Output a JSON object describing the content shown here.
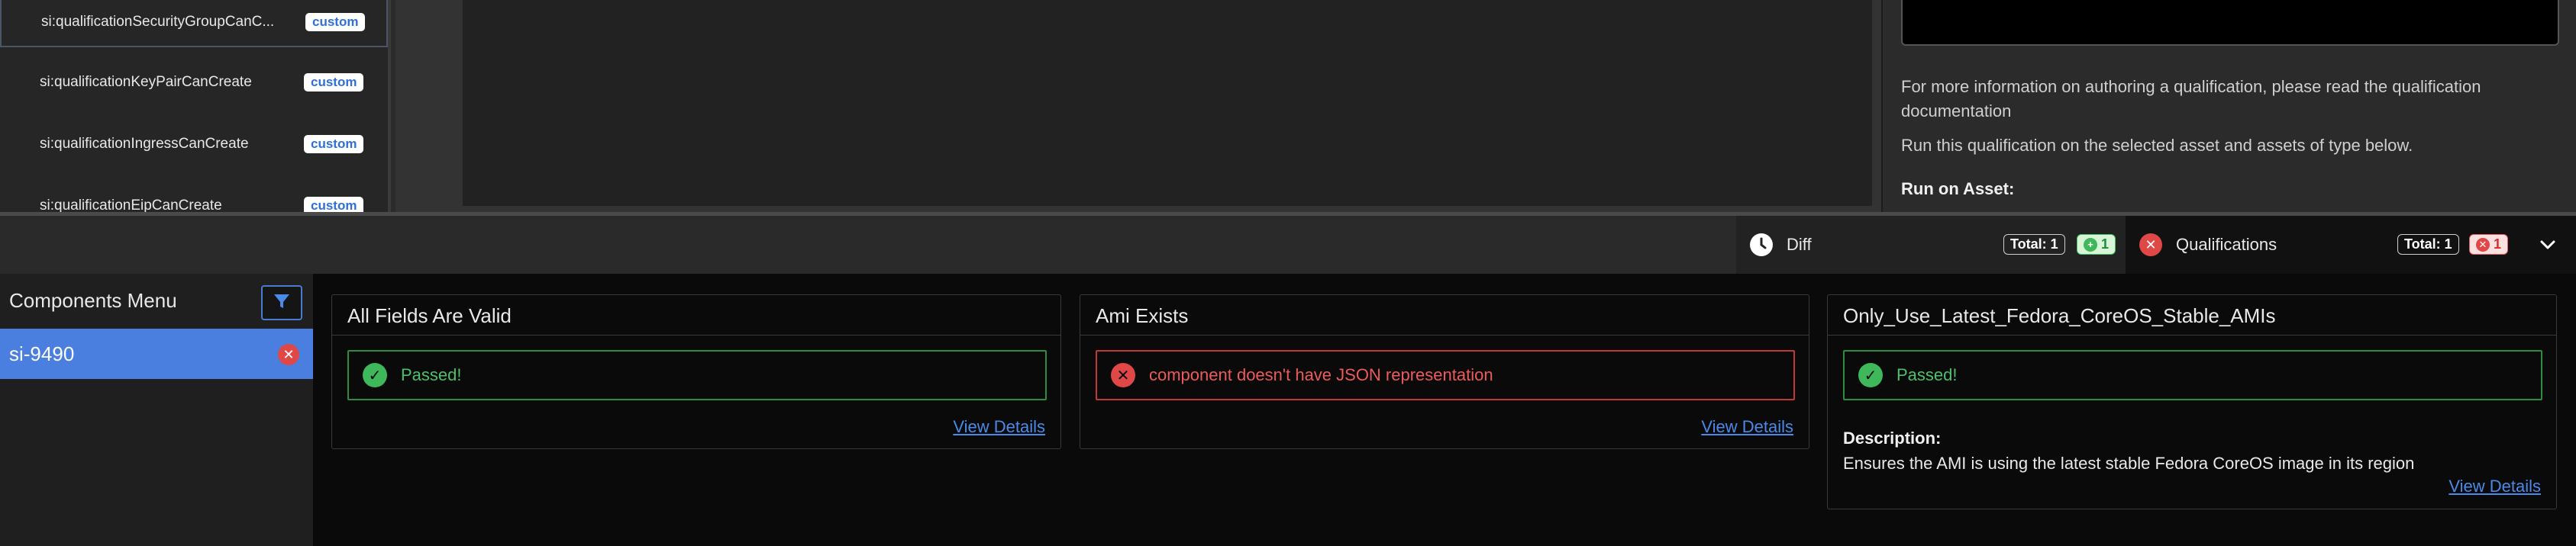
{
  "sidebar": {
    "items": [
      {
        "label": "si:qualificationSecurityGroupCanC...",
        "badge": "custom"
      },
      {
        "label": "si:qualificationKeyPairCanCreate",
        "badge": "custom"
      },
      {
        "label": "si:qualificationIngressCanCreate",
        "badge": "custom"
      },
      {
        "label": "si:qualificationEipCanCreate",
        "badge": "custom"
      }
    ]
  },
  "right_panel": {
    "info_text": "For more information on authoring a qualification, please read the qualification documentation",
    "run_text": "Run this qualification on the selected asset and assets of type below.",
    "run_on_asset_label": "Run on Asset:"
  },
  "tabs": {
    "diff": {
      "label": "Diff",
      "total_label": "Total:",
      "total": "1",
      "count": "1"
    },
    "qualifications": {
      "label": "Qualifications",
      "total_label": "Total:",
      "total": "1",
      "count": "1"
    }
  },
  "components_menu": {
    "title": "Components Menu",
    "items": [
      {
        "label": "si-9490"
      }
    ]
  },
  "cards": [
    {
      "title": "All Fields Are Valid",
      "status": "Passed!",
      "link": "View Details"
    },
    {
      "title": "Ami Exists",
      "status": "component doesn't have JSON representation",
      "link": "View Details"
    },
    {
      "title": "Only_Use_Latest_Fedora_CoreOS_Stable_AMIs",
      "status": "Passed!",
      "description_label": "Description:",
      "description": "Ensures the AMI is using the latest stable Fedora CoreOS image in its region",
      "link": "View Details"
    }
  ],
  "colors": {
    "accent": "#4a7fe0",
    "pass": "#3eb85a",
    "fail": "#e04848"
  }
}
